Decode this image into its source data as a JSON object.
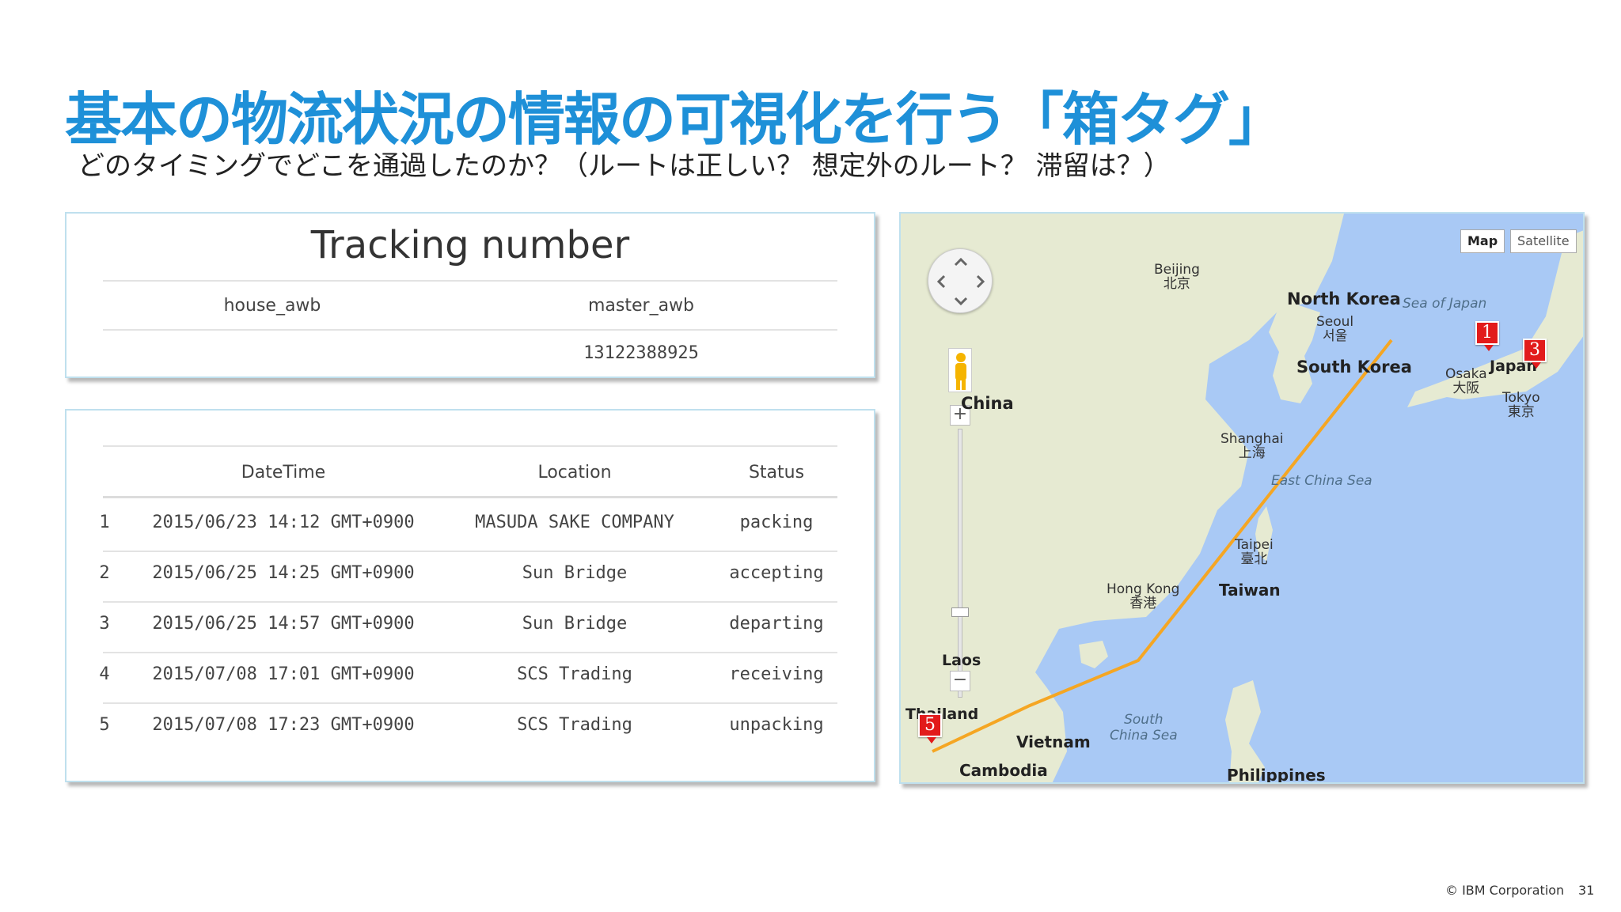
{
  "slide": {
    "title": "基本の物流状況の情報の可視化を行う「箱タグ」",
    "subtitle": "どのタイミングでどこを通過したのか？（ルートは正しい？ 想定外のルート？ 滞留は？）"
  },
  "tracking": {
    "title": "Tracking number",
    "columns": [
      "house_awb",
      "master_awb"
    ],
    "row": [
      "",
      "13122388925"
    ]
  },
  "events": {
    "columns": [
      "",
      "DateTime",
      "Location",
      "Status"
    ],
    "rows": [
      [
        "1",
        "2015/06/23 14:12 GMT+0900",
        "MASUDA SAKE COMPANY",
        "packing"
      ],
      [
        "2",
        "2015/06/25 14:25 GMT+0900",
        "Sun Bridge",
        "accepting"
      ],
      [
        "3",
        "2015/06/25 14:57 GMT+0900",
        "Sun Bridge",
        "departing"
      ],
      [
        "4",
        "2015/07/08 17:01 GMT+0900",
        "SCS Trading",
        "receiving"
      ],
      [
        "5",
        "2015/07/08 17:23 GMT+0900",
        "SCS Trading",
        "unpacking"
      ]
    ]
  },
  "map": {
    "type_buttons": [
      "Map",
      "Satellite"
    ],
    "labels": {
      "beijing": "Beijing\n北京",
      "north_korea": "North Korea",
      "sea_of_japan": "Sea of Japan",
      "seoul": "Seoul\n서울",
      "south_korea": "South Korea",
      "osaka": "Osaka\n大阪",
      "tokyo": "Tokyo\n東京",
      "japan": "Japan",
      "china": "China",
      "shanghai": "Shanghai\n上海",
      "east_china_sea": "East China Sea",
      "taipei": "Taipei\n臺北",
      "taiwan": "Taiwan",
      "hong_kong": "Hong Kong\n香港",
      "laos": "Laos",
      "thailand": "Thailand",
      "vietnam": "Vietnam",
      "cambodia": "Cambodia",
      "south_china_sea": "South\nChina Sea",
      "philippines": "Philippines"
    },
    "markers": [
      "1",
      "3",
      "5"
    ],
    "route_color": "#f5a623",
    "land_color": "#e6ead2",
    "water_color": "#a9c9f5"
  },
  "footer": {
    "copyright": "© IBM Corporation",
    "page": "31"
  }
}
